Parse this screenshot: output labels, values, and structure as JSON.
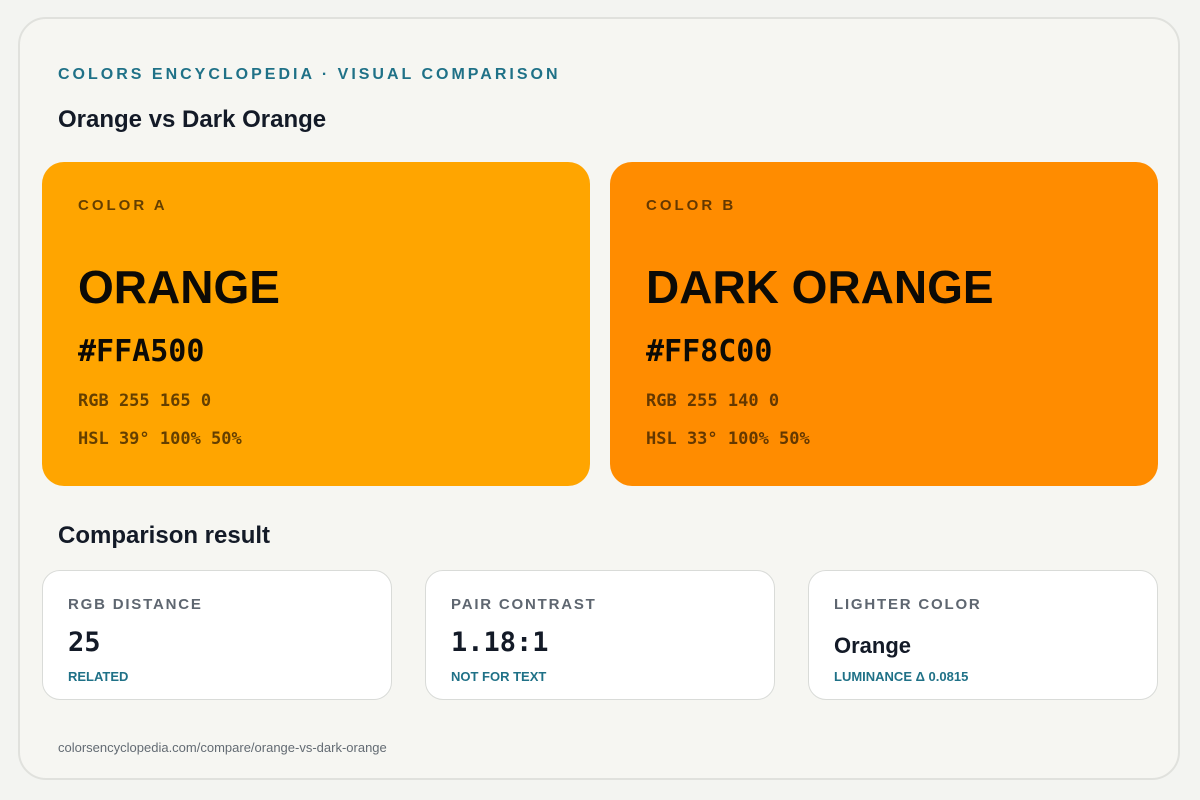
{
  "header": {
    "eyebrow": "COLORS ENCYCLOPEDIA · VISUAL COMPARISON",
    "title": "Orange vs Dark Orange"
  },
  "colors": [
    {
      "side_label": "COLOR A",
      "name": "ORANGE",
      "hex": "#FFA500",
      "rgb": "RGB 255 165 0",
      "hsl": "HSL 39° 100% 50%",
      "swatch_color": "#FFA500"
    },
    {
      "side_label": "COLOR B",
      "name": "DARK ORANGE",
      "hex": "#FF8C00",
      "rgb": "RGB 255 140 0",
      "hsl": "HSL 33° 100% 50%",
      "swatch_color": "#FF8C00"
    }
  ],
  "comparison": {
    "title": "Comparison result",
    "cards": [
      {
        "label": "RGB DISTANCE",
        "value": "25",
        "note": "RELATED"
      },
      {
        "label": "PAIR CONTRAST",
        "value": "1.18:1",
        "note": "NOT FOR TEXT"
      },
      {
        "label": "LIGHTER COLOR",
        "value": "Orange",
        "note": "LUMINANCE Δ 0.0815"
      }
    ]
  },
  "footer": {
    "url": "colorsencyclopedia.com/compare/orange-vs-dark-orange"
  },
  "theme": {
    "accent": "#1F7187",
    "page_background": "#F6F6F2",
    "card_background": "#FFFFFF"
  }
}
